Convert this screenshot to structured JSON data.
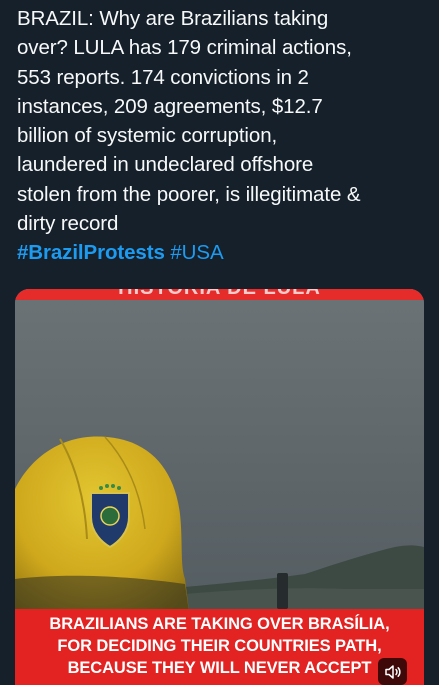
{
  "tweet": {
    "text_lines": [
      "BRAZIL: Why are Brazilians taking",
      "over? LULA has 179 criminal actions,",
      "553 reports. 174 convictions in 2",
      "instances, 209 agreements, $12.7",
      "billion of systemic corruption,",
      "laundered in undeclared offshore",
      "stolen from the poorer, is illegitimate &",
      "dirty record"
    ],
    "hashtags": [
      "#BrazilProtests",
      "#USA"
    ]
  },
  "media": {
    "top_banner_text": "HISTORIA DE LULA",
    "caption_lines": [
      "BRAZILIANS ARE TAKING OVER BRASÍLIA,",
      "FOR DECIDING THEIR COUNTRIES PATH,",
      "BECAUSE THEY WILL NEVER ACCEPT"
    ],
    "mute_icon": "speaker-muted-icon"
  },
  "colors": {
    "background": "#15202b",
    "text": "#f7f9f9",
    "hashtag": "#1d9bf0",
    "banner_red": "#e32222"
  }
}
